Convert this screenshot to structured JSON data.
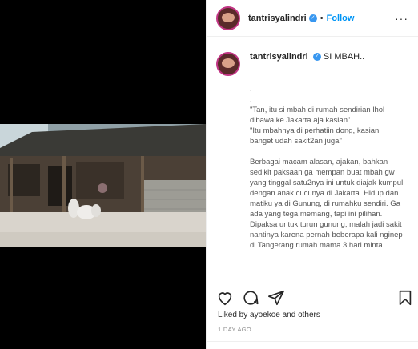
{
  "post": {
    "username": "tantrisyalindri",
    "follow_label": "Follow",
    "separator": "•",
    "more_label": "···",
    "caption_title": "SI MBAH..",
    "caption_body": ".\n.\n\"Tan, itu si mbah di rumah sendirian lhol dibawa ke Jakarta aja kasian\"\n\"Itu mbahnya di perhatiin dong, kasian banget udah sakit2an juga\"\n\nBerbagai macam alasan, ajakan, bahkan sedikit paksaan ga mempan buat mbah gw yang tinggal satu2nya ini untuk diajak kumpul dengan anak cucunya di Jakarta. Hidup dan matiku ya di Gunung, di rumahku sendiri. Ga ada yang tega memang, tapi ini pilihan. Dipaksa untuk turun gunung, malah jadi sakit nantinya karena pernah beberapa kali nginep di Tangerang rumah mama 3 hari minta",
    "liked_by": "Liked by ayoekoe and others",
    "time_ago": "1 DAY AGO"
  },
  "icons": {
    "verified": "verified-badge-icon",
    "like": "heart-icon",
    "comment": "comment-icon",
    "share": "paper-plane-icon",
    "save": "bookmark-icon"
  },
  "colors": {
    "accent": "#0095f6",
    "verified": "#3897f0"
  }
}
